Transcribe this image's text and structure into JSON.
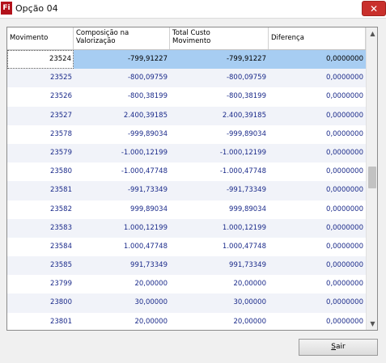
{
  "window": {
    "title": "Opção 04",
    "icon": "fi-logo-icon",
    "close_glyph": "✕"
  },
  "grid": {
    "columns": [
      "Movimento",
      "Composição na\nValorização",
      "Total Custo\nMovimento",
      "Diferença"
    ],
    "rows": [
      [
        "23524",
        "-799,91227",
        "-799,91227",
        "0,0000000"
      ],
      [
        "23525",
        "-800,09759",
        "-800,09759",
        "0,0000000"
      ],
      [
        "23526",
        "-800,38199",
        "-800,38199",
        "0,0000000"
      ],
      [
        "23527",
        "2.400,39185",
        "2.400,39185",
        "0,0000000"
      ],
      [
        "23578",
        "-999,89034",
        "-999,89034",
        "0,0000000"
      ],
      [
        "23579",
        "-1.000,12199",
        "-1.000,12199",
        "0,0000000"
      ],
      [
        "23580",
        "-1.000,47748",
        "-1.000,47748",
        "0,0000000"
      ],
      [
        "23581",
        "-991,73349",
        "-991,73349",
        "0,0000000"
      ],
      [
        "23582",
        "999,89034",
        "999,89034",
        "0,0000000"
      ],
      [
        "23583",
        "1.000,12199",
        "1.000,12199",
        "0,0000000"
      ],
      [
        "23584",
        "1.000,47748",
        "1.000,47748",
        "0,0000000"
      ],
      [
        "23585",
        "991,73349",
        "991,73349",
        "0,0000000"
      ],
      [
        "23799",
        "20,00000",
        "20,00000",
        "0,0000000"
      ],
      [
        "23800",
        "30,00000",
        "30,00000",
        "0,0000000"
      ],
      [
        "23801",
        "20,00000",
        "20,00000",
        "0,0000000"
      ]
    ],
    "selected_row": 0,
    "scroll": {
      "up_glyph": "▲",
      "down_glyph": "▼",
      "position": 0.5
    }
  },
  "footer": {
    "sair_label": "Sair",
    "sair_mnemonic": "S",
    "sair_rest": "air"
  },
  "colors": {
    "selected": "#a7cdf2",
    "alt_row": "#f1f3f9",
    "value_text": "#1a2a8a",
    "close": "#c9302c"
  }
}
